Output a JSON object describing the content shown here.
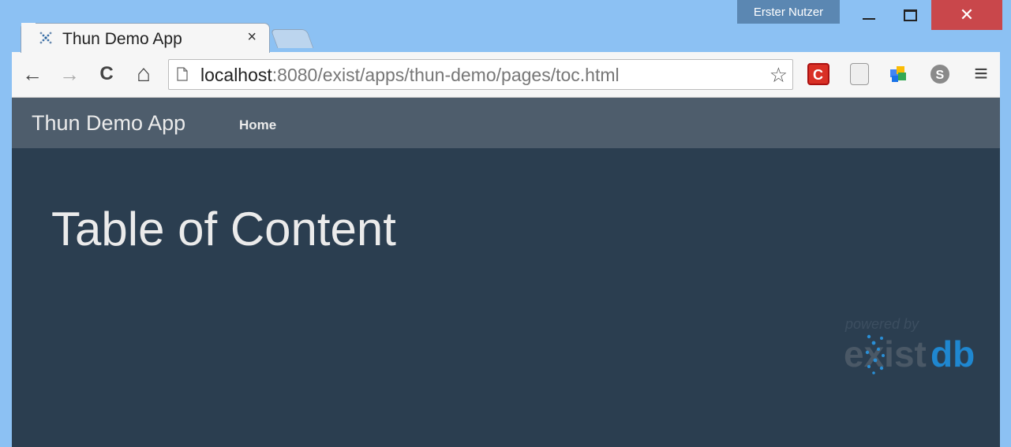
{
  "window": {
    "user_badge": "Erster Nutzer",
    "close_glyph": "✕"
  },
  "tab": {
    "title": "Thun Demo App",
    "close_glyph": "×"
  },
  "toolbar": {
    "back_glyph": "←",
    "forward_glyph": "→",
    "reload_glyph": "C",
    "home_glyph": "⌂",
    "url_host": "localhost",
    "url_rest": ":8080/exist/apps/thun-demo/pages/toc.html",
    "star_glyph": "☆",
    "menu_glyph": "≡",
    "extensions": [
      "c-extension-icon",
      "document-extension-icon",
      "puzzle-extension-icon",
      "skype-icon"
    ]
  },
  "page": {
    "brand": "Thun Demo App",
    "nav_home": "Home",
    "heading": "Table of Content",
    "powered_by": "powered by",
    "logo_prefix": "exist",
    "logo_suffix": "db"
  },
  "colors": {
    "navbar": "#4e5d6c",
    "content": "#2b3e50",
    "text": "#ebebeb"
  }
}
